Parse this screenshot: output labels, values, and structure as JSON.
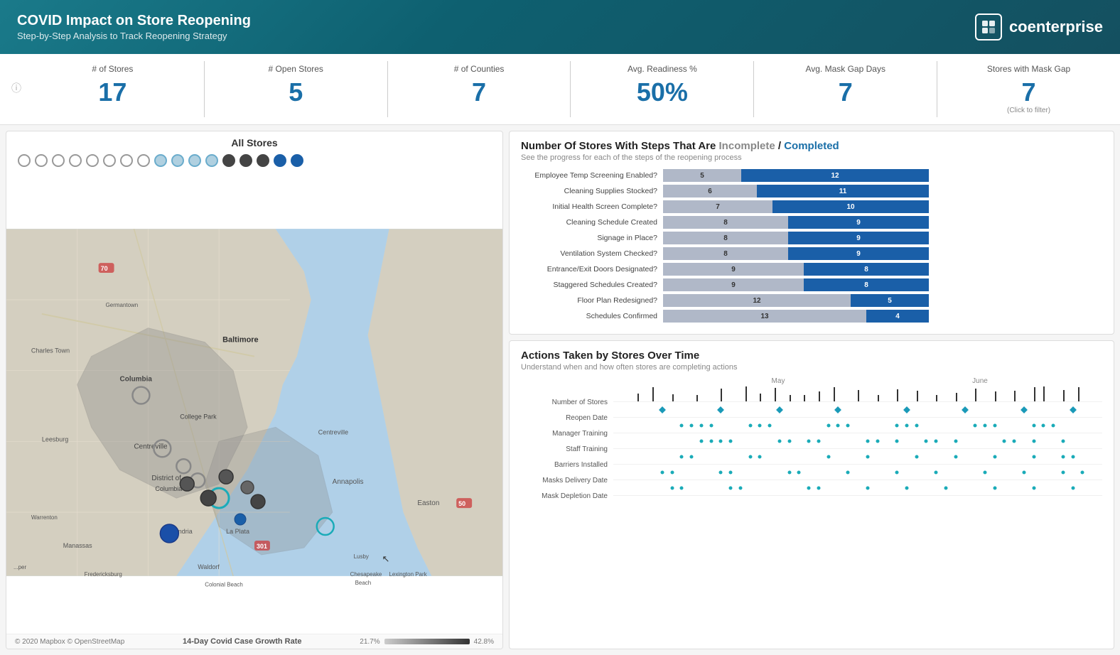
{
  "header": {
    "title": "COVID Impact on Store Reopening",
    "subtitle": "Step-by-Step Analysis to Track Reopening Strategy",
    "logo_text": "coenterprise"
  },
  "kpis": [
    {
      "label": "# of Stores",
      "value": "17",
      "sub": ""
    },
    {
      "label": "# Open Stores",
      "value": "5",
      "sub": ""
    },
    {
      "label": "# of Counties",
      "value": "7",
      "sub": ""
    },
    {
      "label": "Avg. Readiness %",
      "value": "50%",
      "sub": ""
    },
    {
      "label": "Avg. Mask Gap Days",
      "value": "7",
      "sub": ""
    },
    {
      "label": "Stores with Mask Gap",
      "value": "7",
      "sub": "(Click to filter)"
    }
  ],
  "map": {
    "title": "All Stores",
    "footer_left": "© 2020 Mapbox © OpenStreetMap",
    "footer_center": "14-Day Covid Case Growth Rate",
    "legend_min": "21.7%",
    "legend_max": "42.8%"
  },
  "bar_chart": {
    "title_prefix": "Number Of Stores With Steps That Are ",
    "title_incomplete": "Incomplete",
    "title_sep": " / ",
    "title_complete": "Completed",
    "subtitle": "See the progress for each of the steps of the reopening process",
    "rows": [
      {
        "label": "Employee Temp Screening Enabled?",
        "incomplete": 5,
        "complete": 12
      },
      {
        "label": "Cleaning Supplies Stocked?",
        "incomplete": 6,
        "complete": 11
      },
      {
        "label": "Initial Health Screen Complete?",
        "incomplete": 7,
        "complete": 10
      },
      {
        "label": "Cleaning Schedule Created",
        "incomplete": 8,
        "complete": 9
      },
      {
        "label": "Signage in Place?",
        "incomplete": 8,
        "complete": 9
      },
      {
        "label": "Ventilation System Checked?",
        "incomplete": 8,
        "complete": 9
      },
      {
        "label": "Entrance/Exit Doors Designated?",
        "incomplete": 9,
        "complete": 8
      },
      {
        "label": "Staggered Schedules Created?",
        "incomplete": 9,
        "complete": 8
      },
      {
        "label": "Floor Plan Redesigned?",
        "incomplete": 12,
        "complete": 5
      },
      {
        "label": "Schedules Confirmed",
        "incomplete": 13,
        "complete": 4
      }
    ]
  },
  "timeline": {
    "title": "Actions Taken by Stores Over Time",
    "subtitle": "Understand when and how often stores are completing actions",
    "months": [
      "May",
      "June"
    ],
    "rows": [
      "Number of Stores",
      "Reopen Date",
      "Manager Training",
      "Staff Training",
      "Barriers Installed",
      "Masks Delivery Date",
      "Mask Depletion Date"
    ]
  },
  "store_dots": [
    "empty",
    "empty",
    "empty",
    "empty",
    "empty",
    "empty",
    "empty",
    "empty",
    "light",
    "light",
    "light",
    "light",
    "dark",
    "dark",
    "dark",
    "blue",
    "blue"
  ]
}
